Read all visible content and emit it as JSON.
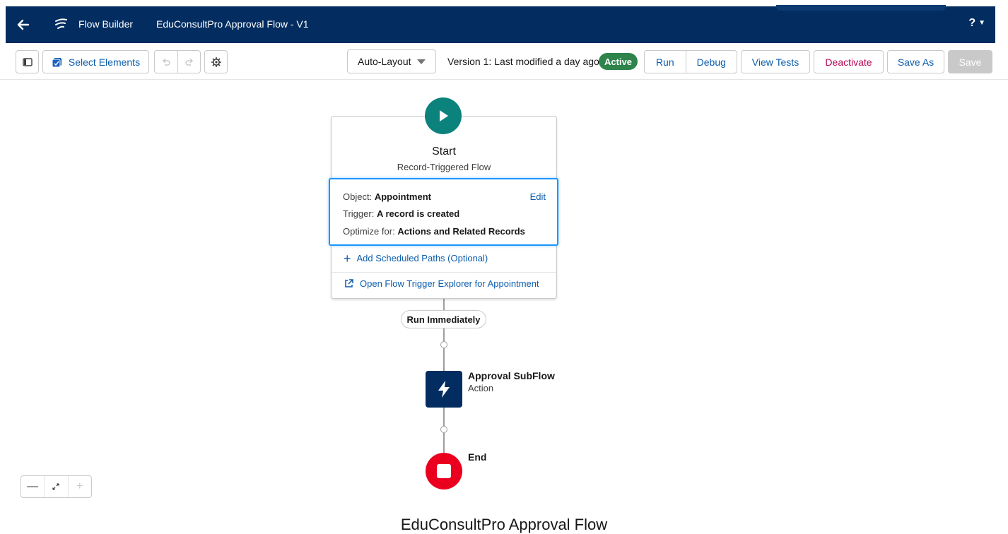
{
  "header": {
    "app_name": "Flow Builder",
    "flow_title": "EduConsultPro Approval Flow - V1",
    "help_label": "?",
    "icons": [
      "back-arrow-icon",
      "flow-builder-logo-icon",
      "chevron-down-icon"
    ]
  },
  "toolbar": {
    "select_elements_label": "Select Elements",
    "layout_select_value": "Auto-Layout",
    "version_text": "Version 1: Last modified a day ago",
    "status_badge": "Active",
    "run_label": "Run",
    "debug_label": "Debug",
    "view_tests_label": "View Tests",
    "deactivate_label": "Deactivate",
    "save_as_label": "Save As",
    "save_label": "Save"
  },
  "start": {
    "title": "Start",
    "subtitle": "Record-Triggered Flow",
    "object_label": "Object:",
    "object_value": "Appointment",
    "trigger_label": "Trigger:",
    "trigger_value": "A record is created",
    "optimize_label": "Optimize for:",
    "optimize_value": "Actions and Related Records",
    "edit_label": "Edit",
    "scheduled_paths_label": "Add Scheduled Paths (Optional)",
    "trigger_explorer_label": "Open Flow Trigger Explorer for Appointment"
  },
  "path": {
    "label": "Run Immediately"
  },
  "action": {
    "title": "Approval SubFlow",
    "subtitle": "Action"
  },
  "end": {
    "label": "End"
  },
  "zoom": {
    "zoom_out": "—",
    "zoom_in": "+"
  },
  "caption": "EduConsultPro Approval Flow",
  "colors": {
    "header_bg": "#032d60",
    "start_icon": "#0b827c",
    "action_icon": "#032d60",
    "end_icon": "#ea001e",
    "active_badge": "#2e844a",
    "link_blue": "#0b5cab",
    "selection_blue": "#1b96ff"
  }
}
